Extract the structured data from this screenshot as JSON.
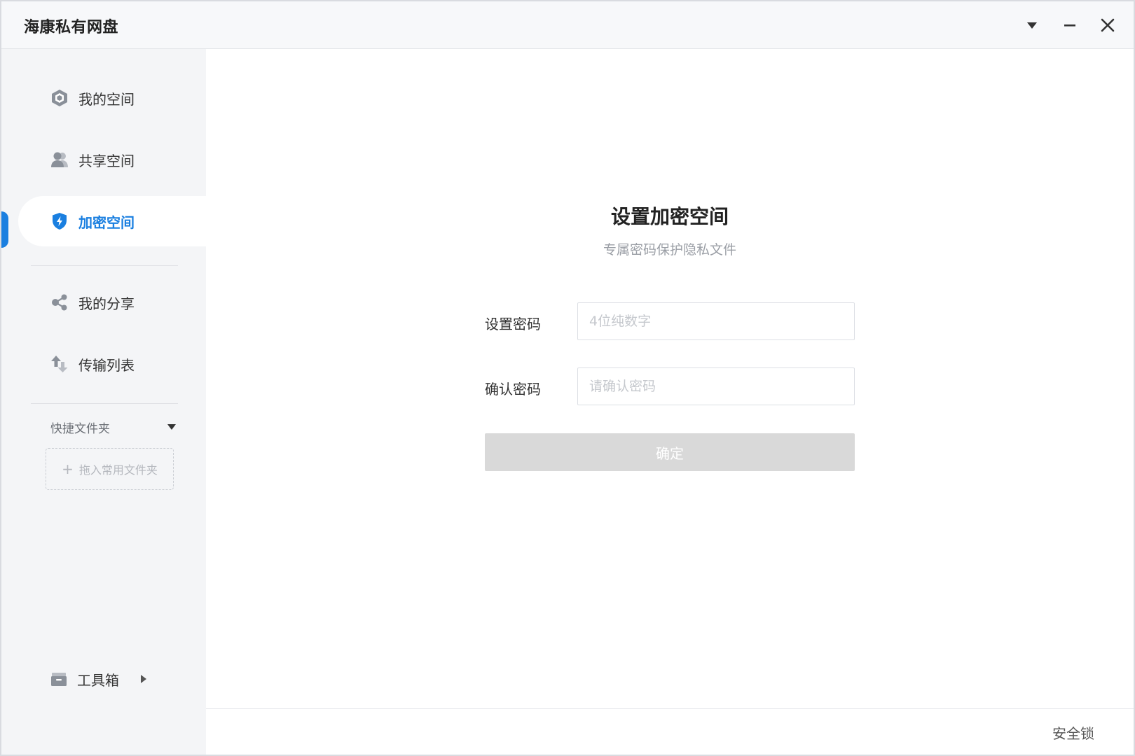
{
  "window": {
    "title": "海康私有网盘"
  },
  "sidebar": {
    "items": [
      {
        "label": "我的空间",
        "icon": "my-space-icon"
      },
      {
        "label": "共享空间",
        "icon": "shared-space-icon"
      },
      {
        "label": "加密空间",
        "icon": "encrypted-space-icon",
        "active": true
      },
      {
        "label": "我的分享",
        "icon": "share-icon"
      },
      {
        "label": "传输列表",
        "icon": "transfer-icon"
      }
    ],
    "quick_folders": {
      "label": "快捷文件夹",
      "drop_hint": "拖入常用文件夹"
    },
    "toolbox": {
      "label": "工具箱"
    }
  },
  "main": {
    "title": "设置加密空间",
    "subtitle": "专属密码保护隐私文件",
    "form": {
      "password_label": "设置密码",
      "password_placeholder": "4位纯数字",
      "password_value": "",
      "confirm_label": "确认密码",
      "confirm_placeholder": "请确认密码",
      "confirm_value": "",
      "submit_label": "确定"
    }
  },
  "footer": {
    "lock_label": "安全锁"
  },
  "colors": {
    "accent": "#1a7fe0",
    "sidebar_bg": "#f4f5f7",
    "disabled_button": "#d9d9d9",
    "icon_gray": "#8a9099"
  }
}
